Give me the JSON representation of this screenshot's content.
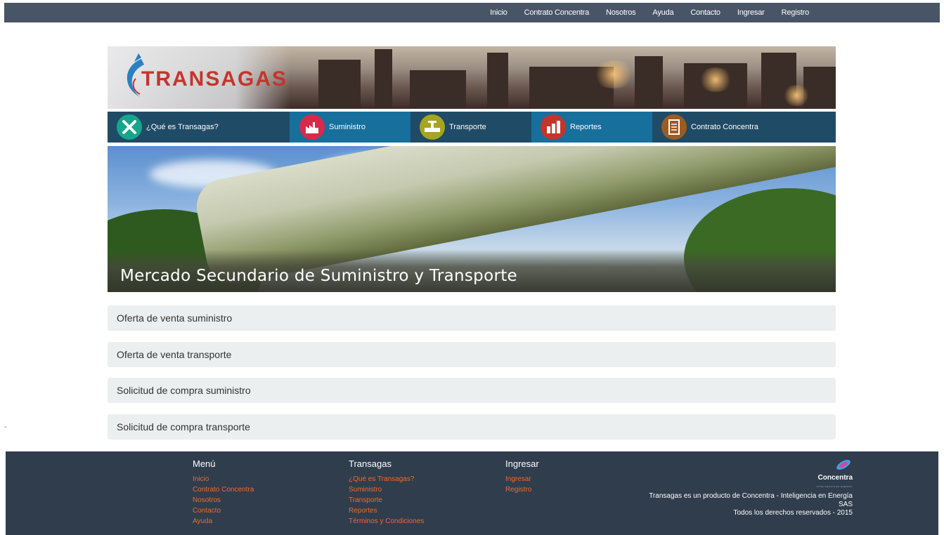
{
  "topnav": {
    "items": [
      "Inicio",
      "Contrato Concentra",
      "Nosotros",
      "Ayuda",
      "Contacto",
      "Ingresar",
      "Registro"
    ]
  },
  "banner": {
    "logo_text": "TRANSAGAS"
  },
  "categories": [
    {
      "label": "¿Qué es Transagas?",
      "color": "#17a58c",
      "icon": "tools-icon"
    },
    {
      "label": "Suministro",
      "color": "#d8294a",
      "icon": "factory-icon"
    },
    {
      "label": "Transporte",
      "color": "#a7a51d",
      "icon": "valve-icon"
    },
    {
      "label": "Reportes",
      "color": "#c3352b",
      "icon": "bar-chart-icon"
    },
    {
      "label": "Contrato Concentra",
      "color": "#9c5b23",
      "icon": "document-icon"
    }
  ],
  "hero": {
    "title": "Mercado Secundario de Suministro y Transporte"
  },
  "accordion": [
    "Oferta de venta suministro",
    "Oferta de venta transporte",
    "Solicitud de compra suministro",
    "Solicitud de compra transporte"
  ],
  "stray_mark": "-",
  "footer": {
    "col1": {
      "title": "Menú",
      "links": [
        "Inicio",
        "Contrato Concentra",
        "Nosotros",
        "Contacto",
        "Ayuda"
      ]
    },
    "col2": {
      "title": "Transagas",
      "links": [
        "¿Qué es Transagas?",
        "Suministro",
        "Transporte",
        "Reportes",
        "Términos y Condiciones"
      ]
    },
    "col3": {
      "title": "Ingresar",
      "links": [
        "Ingresar",
        "Registro"
      ]
    },
    "brand": {
      "name": "Concentra",
      "tagline": "INTELIGENCIA EN ENERGÍA"
    },
    "copyright_line1": "Transagas es un producto de Concentra - Inteligencia en Energía SAS",
    "copyright_line2": "Todos los derechos reservados - 2015"
  },
  "colors": {
    "topnav_bg": "#485566",
    "catbar_bg": "#1f4b66",
    "catbar_alt": "#176f9c",
    "footer_bg": "#2f3d4d",
    "footer_link": "#f06b2a",
    "accordion_bg": "#ecefef"
  }
}
